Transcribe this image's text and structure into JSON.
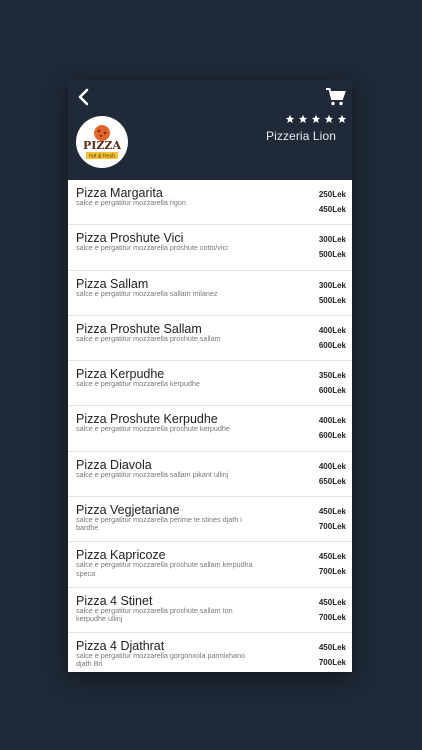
{
  "header": {
    "restaurant_name": "Pizzeria Lion",
    "rating_stars": 5,
    "logo_title": "PIZZA",
    "logo_subtitle": "hot & fresh",
    "back_icon": "chevron-left-icon",
    "cart_icon": "cart-icon",
    "bg_color": "#1f2937"
  },
  "menu": {
    "items": [
      {
        "title": "Pizza Margarita",
        "description": "salce e pergatitur mozzarella rigon",
        "price_small": "250Lek",
        "price_large": "450Lek"
      },
      {
        "title": "Pizza Proshute Vici",
        "description": "salce e pergatitur mozzarella proshute cotto/vici",
        "price_small": "300Lek",
        "price_large": "500Lek"
      },
      {
        "title": "Pizza Sallam",
        "description": "salce e pergatitur mozzarella sallam milanez",
        "price_small": "300Lek",
        "price_large": "500Lek"
      },
      {
        "title": "Pizza Proshute Sallam",
        "description": "salce e pergatitur mozzarella proshute sallam",
        "price_small": "400Lek",
        "price_large": "600Lek"
      },
      {
        "title": "Pizza Kerpudhe",
        "description": "salce e pergatitur mozzarella kerpudhe",
        "price_small": "350Lek",
        "price_large": "600Lek"
      },
      {
        "title": "Pizza Proshute Kerpudhe",
        "description": "salce e pergatitur mozzarella proshute kerpudhe",
        "price_small": "400Lek",
        "price_large": "600Lek"
      },
      {
        "title": "Pizza Diavola",
        "description": "salce e pergatitur mozzarella sallam pikant ullinj",
        "price_small": "400Lek",
        "price_large": "650Lek"
      },
      {
        "title": "Pizza Vegjetariane",
        "description": "salce e pergatitur mozzarella perime te stines djath i bardhe",
        "price_small": "450Lek",
        "price_large": "700Lek"
      },
      {
        "title": "Pizza Kapricoze",
        "description": "salce e pergatitur mozzarella proshute sallam kerpudha speca",
        "price_small": "450Lek",
        "price_large": "700Lek"
      },
      {
        "title": "Pizza 4 Stinet",
        "description": "salce e pergatitur mozzarella proshute sallam ton kerpudhe ullinj",
        "price_small": "450Lek",
        "price_large": "700Lek"
      },
      {
        "title": "Pizza 4 Djathrat",
        "description": "salce e pergatitur mozzarella gorgonxola parmixhano djath Bri",
        "price_small": "450Lek",
        "price_large": "700Lek"
      }
    ]
  }
}
